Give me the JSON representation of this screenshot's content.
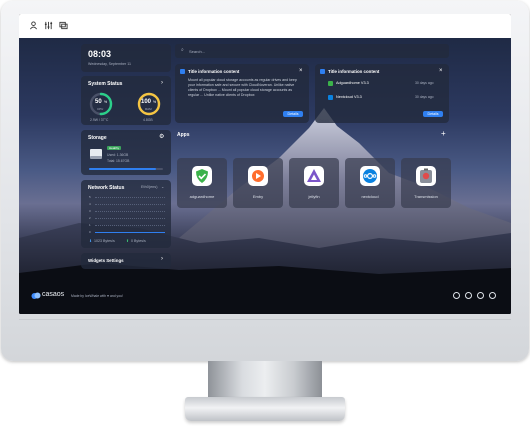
{
  "topbar": {
    "icons": [
      "person-icon",
      "sliders-icon",
      "layers-icon"
    ]
  },
  "clock": {
    "time": "08:03",
    "date": "Wednesday, September 11"
  },
  "system_status": {
    "title": "System Status",
    "cpu_percent": "50",
    "cpu_unit": "%",
    "cpu_label": "CPU",
    "cpu_detail": "2.9W / 37°C",
    "ram_percent": "100",
    "ram_unit": "%",
    "ram_label": "RAM",
    "ram_detail": "4.8GB"
  },
  "storage": {
    "title": "Storage",
    "badge": "Healthy",
    "used": "Used: 1.36GB",
    "total": "Total: 15.67GB",
    "fill_fraction": 0.9
  },
  "network": {
    "title": "Network Status",
    "interface": "Eth0(ens)",
    "ticks": [
      "5",
      "4",
      "3",
      "2",
      "1",
      "0"
    ],
    "down": "1023 Bytes/s",
    "up": "0 Bytes/s"
  },
  "widgets": {
    "label": "Widgets Settings"
  },
  "search": {
    "placeholder": "Search..."
  },
  "notice1": {
    "title": "Title information content",
    "body": "Mount all popular cloud storage accounts as regular drives and keep your information safe and secure with CloudNoveran. Unlike native clients of Dropbox ... Mount all popular cloud storage accounts as regular ... Unlike native clients of Dropbox",
    "button": "Details",
    "extra": "Details"
  },
  "notice2": {
    "title": "Title information content",
    "rows": [
      {
        "name": "Adguardhome V3.3",
        "time": "30 days ago"
      },
      {
        "name": "Nextcloud V3.3",
        "time": "30 days ago"
      }
    ],
    "button": "Details"
  },
  "apps": {
    "title": "Apps",
    "add": "+",
    "items": [
      {
        "name": "adguardhome",
        "icon": "shield-check-icon",
        "color": "#3bb24a"
      },
      {
        "name": "Emby",
        "icon": "gear-play-icon",
        "color": "#ff6d2d"
      },
      {
        "name": "jellyfin",
        "icon": "triangle-icon",
        "color": "#7b55c9"
      },
      {
        "name": "nextcloud",
        "icon": "nextcloud-icon",
        "color": "#0a82e0"
      },
      {
        "name": "Transmission",
        "icon": "transmission-icon",
        "color": "#8a8f9a"
      }
    ]
  },
  "footer": {
    "logo": "casaos",
    "tagline": "Made by IceWhale with ♥ and you!",
    "icons": [
      "github-icon",
      "discord-icon",
      "forum-icon",
      "settings-icon"
    ]
  }
}
